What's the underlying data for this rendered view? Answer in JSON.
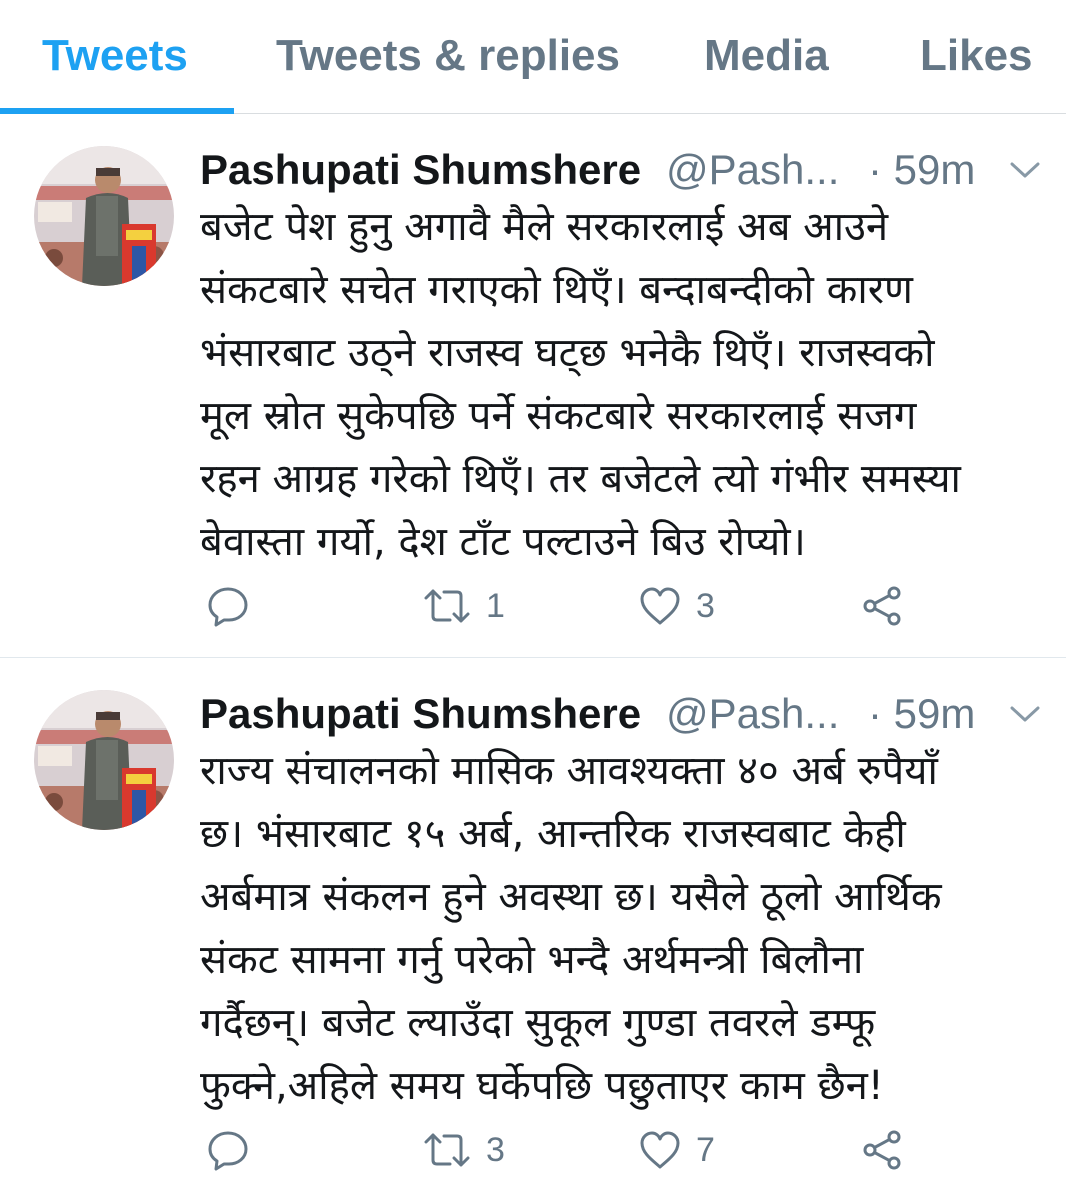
{
  "tabs": [
    {
      "label": "Tweets",
      "active": true
    },
    {
      "label": "Tweets & replies",
      "active": false
    },
    {
      "label": "Media",
      "active": false
    },
    {
      "label": "Likes",
      "active": false
    }
  ],
  "colors": {
    "accent": "#1da1f2",
    "secondary_text": "#657786",
    "primary_text": "#14171a"
  },
  "tweets": [
    {
      "author_name": "Pashupati Shumshere",
      "author_handle": "@Pash...",
      "time": "· 59m",
      "text_lines": [
        "बजेट पेश हुनु अगावै मैले सरकारलाई अब आउने",
        "संकटबारे सचेत गराएको थिएँ। बन्दाबन्दीको कारण",
        "भंसारबाट उठ्ने राजस्व घट्छ भनेकै थिएँ। राजस्वको",
        "मूल स्रोत सुकेपछि पर्ने संकटबारे सरकारलाई सजग",
        "रहन आग्रह गरेको थिएँ। तर बजेटले त्यो गंभीर समस्या",
        "बेवास्ता गर्यो, देश टाँट पल्टाउने बिउ रोप्यो।"
      ],
      "actions": {
        "reply_icon": "reply-icon",
        "retweet_icon": "retweet-icon",
        "retweet_count": "1",
        "like_icon": "heart-icon",
        "like_count": "3",
        "share_icon": "share-icon"
      }
    },
    {
      "author_name": "Pashupati Shumshere",
      "author_handle": "@Pash...",
      "time": "· 59m",
      "text_lines": [
        "राज्य संचालनको मासिक आवश्यक्ता ४० अर्ब रुपैयाँ",
        "छ। भंसारबाट १५ अर्ब, आन्तरिक राजस्वबाट केही",
        "अर्बमात्र संकलन हुने अवस्था छ। यसैले ठूलो आर्थिक",
        "संकट सामना गर्नु परेको भन्दै अर्थमन्त्री बिलौना",
        "गर्दैछन्। बजेट ल्याउँदा सुकूल गुण्डा तवरले डम्फू",
        "फुक्ने,अहिले समय घर्केपछि पछुताएर काम छैन!"
      ],
      "actions": {
        "reply_icon": "reply-icon",
        "retweet_icon": "retweet-icon",
        "retweet_count": "3",
        "like_icon": "heart-icon",
        "like_count": "7",
        "share_icon": "share-icon"
      }
    }
  ]
}
